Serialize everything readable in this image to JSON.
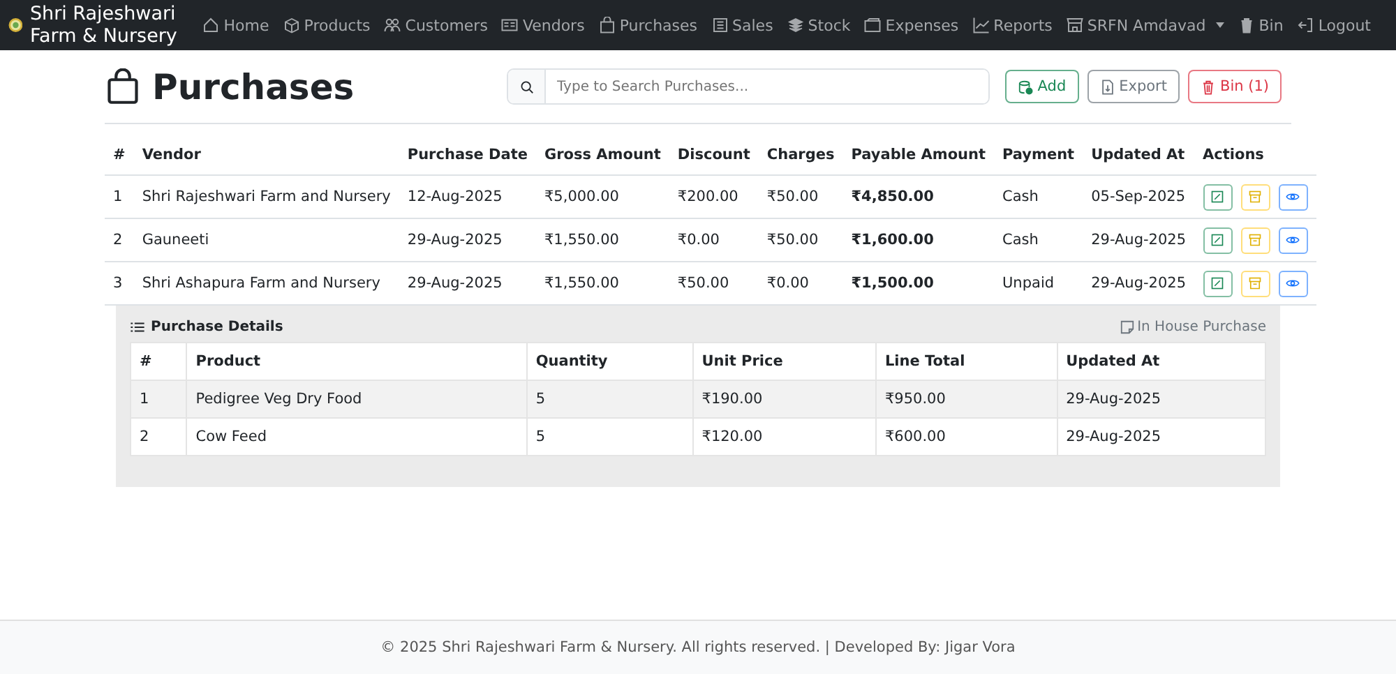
{
  "navbar": {
    "brand": "Shri Rajeshwari Farm & Nursery",
    "items": [
      "Home",
      "Products",
      "Customers",
      "Vendors",
      "Purchases",
      "Sales",
      "Stock",
      "Expenses",
      "Reports"
    ],
    "branch": "SRFN Amdavad",
    "right_items": [
      "Bin",
      "Logout"
    ]
  },
  "page": {
    "title": "Purchases",
    "search": {
      "placeholder": "Type to Search Purchases..."
    },
    "buttons": [
      "Add",
      "Export",
      "Bin (1)"
    ]
  },
  "table": {
    "columns": [
      "#",
      "Vendor",
      "Purchase Date",
      "Gross Amount",
      "Discount",
      "Charges",
      "Payable Amount",
      "Payment",
      "Updated At",
      "Actions"
    ],
    "rows": [
      [
        "1",
        "Shri Rajeshwari Farm and Nursery",
        "12-Aug-2025",
        "₹5,000.00",
        "₹200.00",
        "₹50.00",
        "₹4,850.00",
        "Cash",
        "05-Sep-2025"
      ],
      [
        "2",
        "Gauneeti",
        "29-Aug-2025",
        "₹1,550.00",
        "₹0.00",
        "₹50.00",
        "₹1,600.00",
        "Cash",
        "29-Aug-2025"
      ],
      [
        "3",
        "Shri Ashapura Farm and Nursery",
        "29-Aug-2025",
        "₹1,550.00",
        "₹50.00",
        "₹0.00",
        "₹1,500.00",
        "Unpaid",
        "29-Aug-2025"
      ]
    ]
  },
  "details": {
    "title": "Purchase Details",
    "note": "In House Purchase",
    "columns": [
      "#",
      "Product",
      "Quantity",
      "Unit Price",
      "Line Total",
      "Updated At"
    ],
    "rows": [
      [
        "1",
        "Pedigree Veg Dry Food",
        "5",
        "₹190.00",
        "₹950.00",
        "29-Aug-2025"
      ],
      [
        "2",
        "Cow Feed",
        "5",
        "₹120.00",
        "₹600.00",
        "29-Aug-2025"
      ]
    ]
  },
  "footer": "© 2025 Shri Rajeshwari Farm & Nursery. All rights reserved. | Developed By: Jigar Vora"
}
